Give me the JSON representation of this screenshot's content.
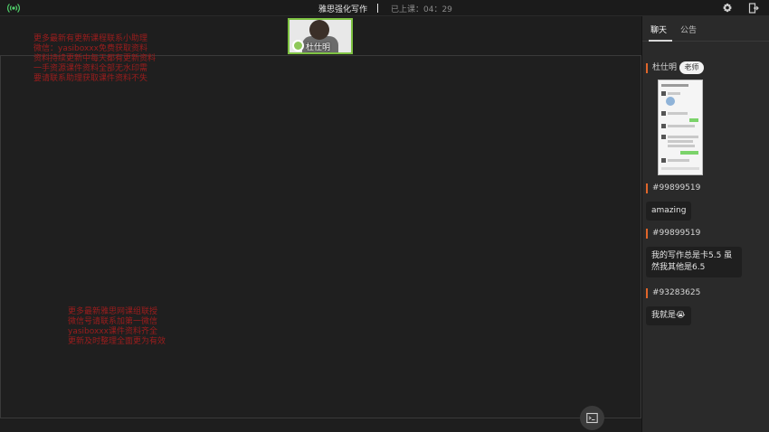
{
  "topbar": {
    "title": "雅思强化写作",
    "elapsed": "已上课：04：29"
  },
  "video": {
    "teacher_name": "杜仕明"
  },
  "watermarks": {
    "top": "更多最新有更新课程联系小助理\n微信：yasiboxxx免费获取资料\n资料持续更新中每天都有更新资料\n一手资源课件资料全部无水印需\n要请联系助理获取课件资料不失",
    "bottom": "更多最新雅思网课组联授\n微信号请联系加第一微信\nyasiboxxx课件资料齐全\n更新及时整理全面更为有效"
  },
  "panel": {
    "tabs": [
      {
        "label": "聊天",
        "active": true
      },
      {
        "label": "公告",
        "active": false
      }
    ],
    "messages": [
      {
        "sender": "杜仕明",
        "role": "老师",
        "type": "image"
      },
      {
        "sender": "#99899519",
        "text": "amazing"
      },
      {
        "sender": "#99899519",
        "text": "我的写作总是卡5.5 虽然我其他是6.5"
      },
      {
        "sender": "#93283625",
        "text": "我就是😭"
      }
    ]
  },
  "colors": {
    "accent_green": "#7ec242",
    "sender_bar": "#e0652a",
    "watermark": "#9c1d1d"
  }
}
